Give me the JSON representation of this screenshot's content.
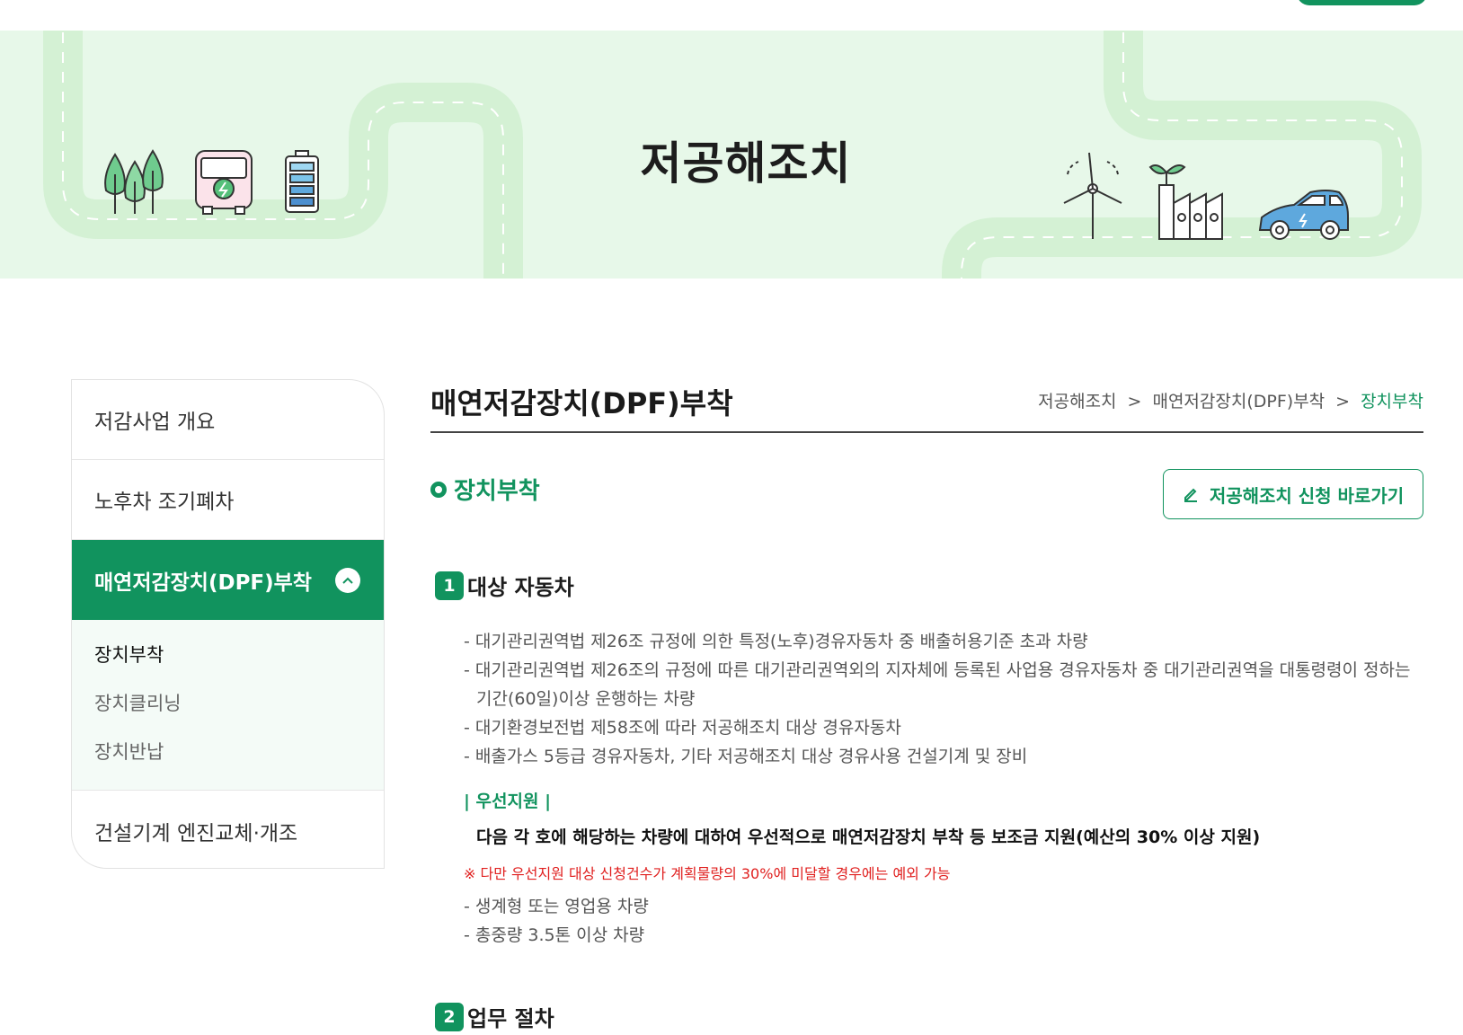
{
  "hero": {
    "title": "저공해조치"
  },
  "sidebar": {
    "items": [
      {
        "label": "저감사업 개요"
      },
      {
        "label": "노후차 조기폐차"
      },
      {
        "label": "매연저감장치(DPF)부착"
      },
      {
        "label": "건설기계 엔진교체·개조"
      }
    ],
    "sub_items": [
      {
        "label": "장치부착"
      },
      {
        "label": "장치클리닝"
      },
      {
        "label": "장치반납"
      }
    ]
  },
  "main": {
    "title": "매연저감장치(DPF)부착",
    "breadcrumb": [
      "저공해조치",
      "매연저감장치(DPF)부착",
      "장치부착"
    ],
    "breadcrumb_sep": ">",
    "section_title": "장치부착",
    "apply_button": "저공해조치 신청 바로가기",
    "steps": [
      {
        "num": "1",
        "title": "대상 자동차"
      },
      {
        "num": "2",
        "title": "업무 절차"
      }
    ],
    "target_items": [
      "대기관리권역법 제26조 규정에 의한 특정(노후)경유자동차 중 배출허용기준 초과 차량",
      "대기관리권역법 제26조의 규정에 따른 대기관리권역외의 지자체에 등록된 사업용 경유자동차 중 대기관리권역을 대통령령이 정하는 기간(60일)이상 운행하는 차량",
      "대기환경보전법 제58조에 따라 저공해조치 대상 경유자동차",
      "배출가스 5등급 경유자동차, 기타 저공해조치 대상 경유사용 건설기계 및 장비"
    ],
    "priority": {
      "label": "| 우선지원 |",
      "main": "다음 각 호에 해당하는 차량에 대하여 우선적으로 매연저감장치 부착 등 보조금 지원(예산의 30% 이상 지원)",
      "note": "※ 다만 우선지원 대상 신청건수가 계획물량의 30%에 미달할 경우에는 예외 가능",
      "items": [
        "생계형 또는 영업용 차량",
        "총중량 3.5톤 이상 차량"
      ]
    }
  },
  "colors": {
    "accent": "#11935e",
    "hero_bg": "#e7f8e9",
    "road": "#d4f1d4",
    "warn": "#e0201f"
  },
  "icons": [
    "trees-icon",
    "electric-bus-icon",
    "battery-icon",
    "wind-turbine-icon",
    "green-factory-icon",
    "electric-car-icon",
    "chevron-up-icon",
    "pencil-icon"
  ]
}
